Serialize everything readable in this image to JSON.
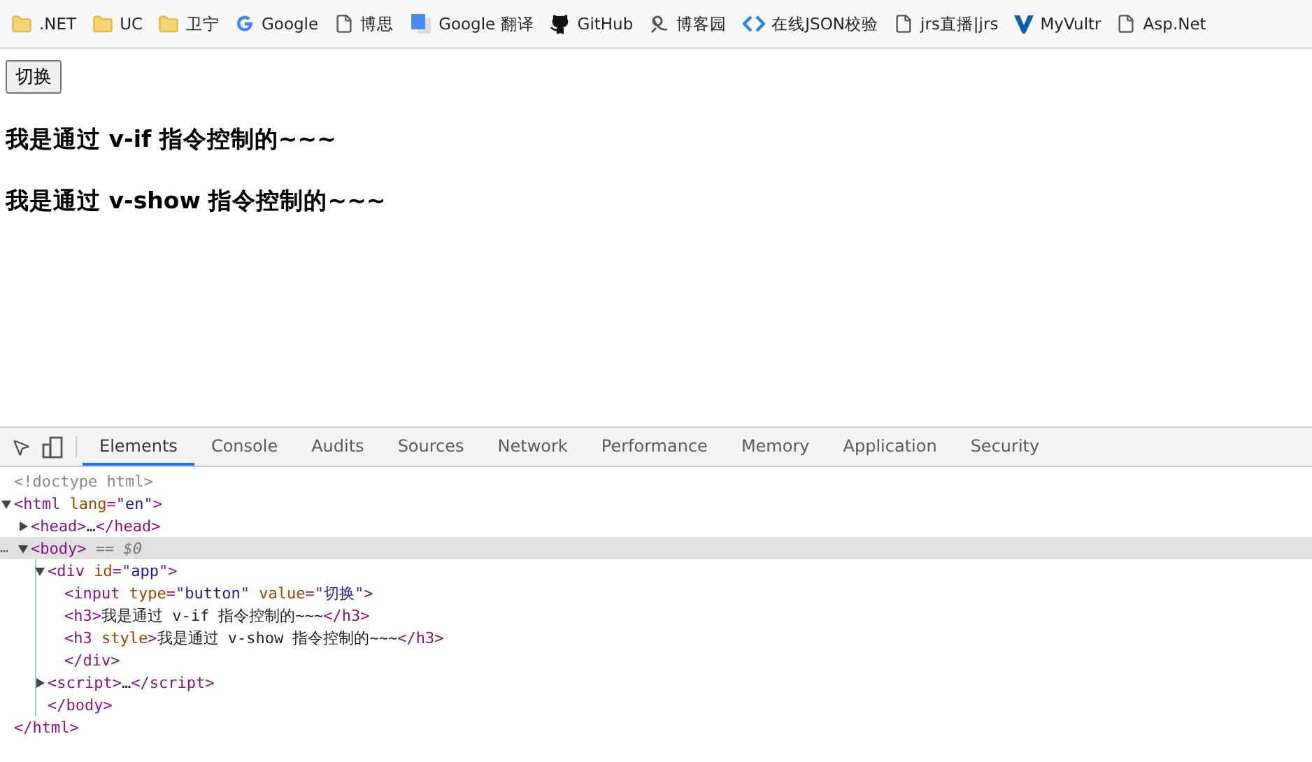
{
  "bookmarks": [
    {
      "label": ".NET",
      "kind": "folder"
    },
    {
      "label": "UC",
      "kind": "folder"
    },
    {
      "label": "卫宁",
      "kind": "folder"
    },
    {
      "label": "Google",
      "kind": "google"
    },
    {
      "label": "博思",
      "kind": "page"
    },
    {
      "label": "Google 翻译",
      "kind": "translate"
    },
    {
      "label": "GitHub",
      "kind": "github"
    },
    {
      "label": "博客园",
      "kind": "blog"
    },
    {
      "label": "在线JSON校验",
      "kind": "code"
    },
    {
      "label": "jrs直播|jrs",
      "kind": "page"
    },
    {
      "label": "MyVultr",
      "kind": "vultr"
    },
    {
      "label": "Asp.Net",
      "kind": "page"
    }
  ],
  "page": {
    "button": "切换",
    "headings": [
      "我是通过 v-if 指令控制的~~~",
      "我是通过 v-show 指令控制的~~~"
    ]
  },
  "devtools": {
    "tabs": [
      {
        "label": "Elements",
        "selected": true
      },
      {
        "label": "Console",
        "selected": false
      },
      {
        "label": "Audits",
        "selected": false
      },
      {
        "label": "Sources",
        "selected": false
      },
      {
        "label": "Network",
        "selected": false
      },
      {
        "label": "Performance",
        "selected": false
      },
      {
        "label": "Memory",
        "selected": false
      },
      {
        "label": "Application",
        "selected": false
      },
      {
        "label": "Security",
        "selected": false
      }
    ],
    "tree": [
      {
        "kind": "leaf",
        "selected": false,
        "parts": [
          {
            "kind": "comment",
            "text": "<!doctype html>"
          }
        ]
      },
      {
        "kind": "expandable",
        "expanded": true,
        "selected": false,
        "parts": [
          {
            "kind": "tag",
            "text": "<html"
          },
          {
            "kind": "attr",
            "text": " lang"
          },
          {
            "kind": "tag",
            "text": "=\""
          },
          {
            "kind": "value",
            "text": "en"
          },
          {
            "kind": "tag",
            "text": "\">"
          }
        ],
        "children": [
          {
            "kind": "expandable",
            "expanded": false,
            "selected": false,
            "parts": [
              {
                "kind": "tag",
                "text": "<head>"
              },
              {
                "kind": "text",
                "text": "…"
              },
              {
                "kind": "tag",
                "text": "</head>"
              }
            ]
          },
          {
            "kind": "expandable",
            "expanded": true,
            "selected": true,
            "gutter": "…",
            "parts": [
              {
                "kind": "tag",
                "text": "<body>"
              },
              {
                "kind": "marker",
                "text": " == $0"
              }
            ],
            "children": [
              {
                "kind": "expandable",
                "expanded": true,
                "selected": false,
                "parts": [
                  {
                    "kind": "tag",
                    "text": "<div"
                  },
                  {
                    "kind": "attr",
                    "text": " id"
                  },
                  {
                    "kind": "tag",
                    "text": "=\""
                  },
                  {
                    "kind": "value",
                    "text": "app"
                  },
                  {
                    "kind": "tag",
                    "text": "\">"
                  }
                ],
                "children": [
                  {
                    "kind": "leaf",
                    "selected": false,
                    "parts": [
                      {
                        "kind": "tag",
                        "text": "<input"
                      },
                      {
                        "kind": "attr",
                        "text": " type"
                      },
                      {
                        "kind": "tag",
                        "text": "=\""
                      },
                      {
                        "kind": "value",
                        "text": "button"
                      },
                      {
                        "kind": "tag",
                        "text": "\""
                      },
                      {
                        "kind": "attr",
                        "text": " value"
                      },
                      {
                        "kind": "tag",
                        "text": "=\""
                      },
                      {
                        "kind": "value",
                        "text": "切换"
                      },
                      {
                        "kind": "tag",
                        "text": "\">"
                      }
                    ]
                  },
                  {
                    "kind": "leaf",
                    "selected": false,
                    "parts": [
                      {
                        "kind": "tag",
                        "text": "<h3>"
                      },
                      {
                        "kind": "text",
                        "text": "我是通过 v-if 指令控制的~~~"
                      },
                      {
                        "kind": "tag",
                        "text": "</h3>"
                      }
                    ]
                  },
                  {
                    "kind": "leaf",
                    "selected": false,
                    "parts": [
                      {
                        "kind": "tag",
                        "text": "<h3"
                      },
                      {
                        "kind": "attr",
                        "text": " style"
                      },
                      {
                        "kind": "tag",
                        "text": ">"
                      },
                      {
                        "kind": "text",
                        "text": "我是通过 v-show 指令控制的~~~"
                      },
                      {
                        "kind": "tag",
                        "text": "</h3>"
                      }
                    ]
                  },
                  {
                    "kind": "leaf",
                    "selected": false,
                    "parts": [
                      {
                        "kind": "tag",
                        "text": "</div>"
                      }
                    ]
                  }
                ]
              },
              {
                "kind": "expandable",
                "expanded": false,
                "selected": false,
                "parts": [
                  {
                    "kind": "tag",
                    "text": "<script>"
                  },
                  {
                    "kind": "text",
                    "text": "…"
                  },
                  {
                    "kind": "tag",
                    "text": "</script>"
                  }
                ]
              },
              {
                "kind": "leaf",
                "selected": false,
                "parts": [
                  {
                    "kind": "tag",
                    "text": "</body>"
                  }
                ]
              }
            ]
          }
        ]
      },
      {
        "kind": "leaf",
        "selected": false,
        "parts": [
          {
            "kind": "tag",
            "text": "</html>"
          }
        ]
      }
    ]
  }
}
